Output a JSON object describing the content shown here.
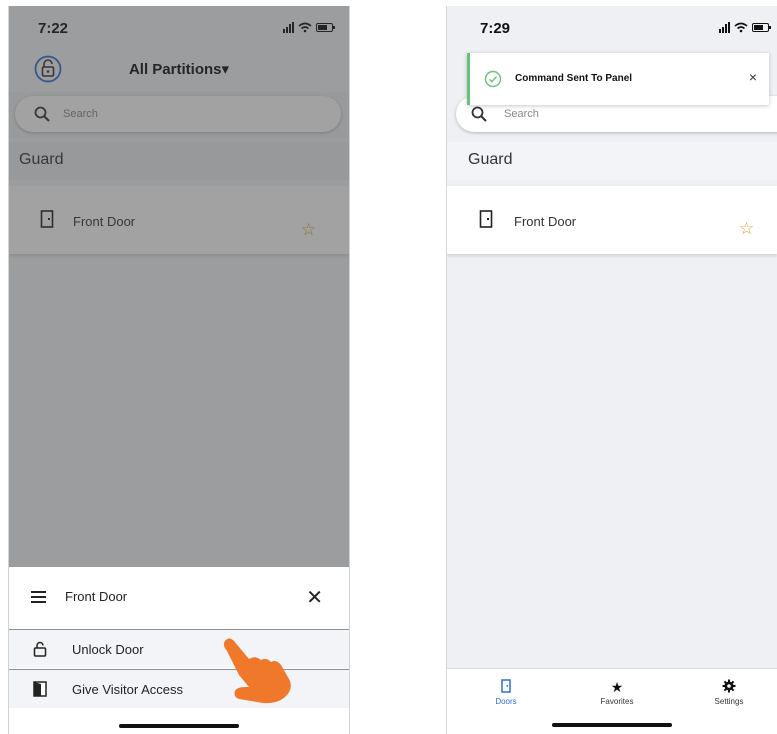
{
  "left_screen": {
    "status_time": "7:22",
    "partition_selector": "All Partitions▾",
    "search_placeholder": "Search",
    "section_title": "Guard",
    "door": {
      "name": "Front Door"
    },
    "sheet": {
      "title": "Front Door",
      "close_label": "✕",
      "actions": [
        {
          "label": "Unlock Door",
          "icon": "unlock-icon"
        },
        {
          "label": "Give Visitor Access",
          "icon": "visitor-door-icon"
        }
      ]
    }
  },
  "right_screen": {
    "status_time": "7:29",
    "toast": {
      "message": "Command Sent To Panel",
      "close_label": "×"
    },
    "search_placeholder": "Search",
    "section_title": "Guard",
    "door": {
      "name": "Front Door"
    },
    "tabs": [
      {
        "label": "Doors",
        "icon": "door-icon",
        "active": true
      },
      {
        "label": "Favorites",
        "icon": "star-icon",
        "active": false
      },
      {
        "label": "Settings",
        "icon": "gear-icon",
        "active": false
      }
    ]
  },
  "colors": {
    "accent_blue": "#2f6fd6",
    "star_gold": "#d9a21e",
    "toast_success": "#67c378",
    "pointer_orange": "#f0782a"
  }
}
